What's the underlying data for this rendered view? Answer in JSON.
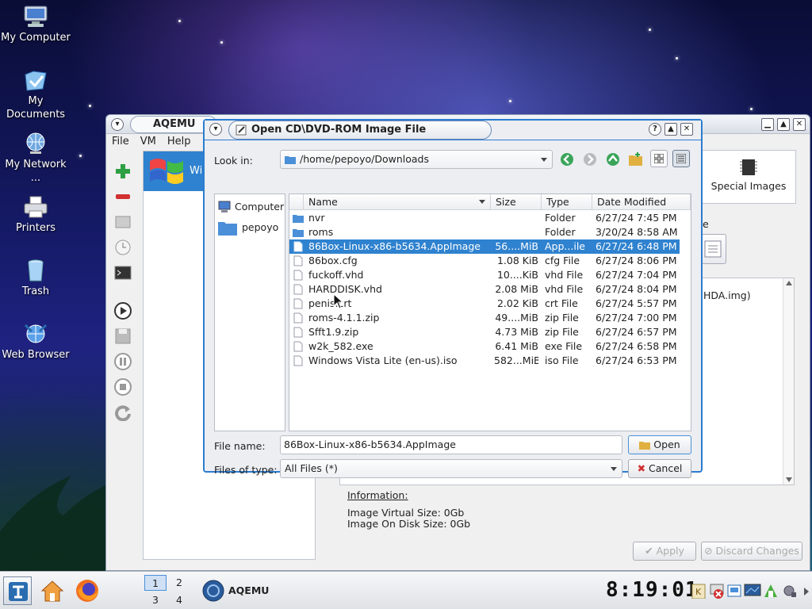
{
  "desktop": {
    "icons": [
      {
        "label": "My Computer",
        "icon": "computer-icon"
      },
      {
        "label": "My Documents",
        "icon": "documents-icon"
      },
      {
        "label": "My Network ...",
        "icon": "network-icon"
      },
      {
        "label": "Printers",
        "icon": "printer-icon"
      },
      {
        "label": "Trash",
        "icon": "trash-icon"
      },
      {
        "label": "Web Browser",
        "icon": "web-browser-icon"
      }
    ]
  },
  "aqemu": {
    "title": "AQEMU",
    "menu": [
      "File",
      "VM",
      "Help"
    ],
    "vm_item": "Wi",
    "special_images": "Special Images",
    "partial_label": "e",
    "hda_text": "HDA.img)",
    "information_label": "Information:",
    "virtual_size": "Image Virtual Size: 0Gb",
    "disk_size": "Image On Disk Size: 0Gb",
    "apply_button": "Apply",
    "discard_button": "Discard Changes"
  },
  "dialog": {
    "title": "Open CD\\DVD-ROM Image File",
    "look_in_label": "Look in:",
    "look_in_value": "/home/pepoyo/Downloads",
    "sidebar": [
      "Computer",
      "pepoyo"
    ],
    "columns": [
      "Name",
      "Size",
      "Type",
      "Date Modified"
    ],
    "files": [
      {
        "name": "nvr",
        "size": "",
        "type": "Folder",
        "date": "6/27/24 7:45 PM",
        "kind": "folder"
      },
      {
        "name": "roms",
        "size": "",
        "type": "Folder",
        "date": "3/20/24 8:58 AM",
        "kind": "folder"
      },
      {
        "name": "86Box-Linux-x86-b5634.AppImage",
        "size": "56....MiB",
        "type": "App...ile",
        "date": "6/27/24 6:48 PM",
        "kind": "file",
        "selected": true
      },
      {
        "name": "86box.cfg",
        "size": "1.08 KiB",
        "type": "cfg File",
        "date": "6/27/24 8:06 PM",
        "kind": "file"
      },
      {
        "name": "fuckoff.vhd",
        "size": "10....KiB",
        "type": "vhd File",
        "date": "6/27/24 7:04 PM",
        "kind": "file"
      },
      {
        "name": "HARDDISK.vhd",
        "size": "2.08 MiB",
        "type": "vhd File",
        "date": "6/27/24 8:04 PM",
        "kind": "file"
      },
      {
        "name": "penis.crt",
        "size": "2.02 KiB",
        "type": "crt File",
        "date": "6/27/24 5:57 PM",
        "kind": "file"
      },
      {
        "name": "roms-4.1.1.zip",
        "size": "49....MiB",
        "type": "zip File",
        "date": "6/27/24 7:00 PM",
        "kind": "file"
      },
      {
        "name": "Sfft1.9.zip",
        "size": "4.73 MiB",
        "type": "zip File",
        "date": "6/27/24 6:57 PM",
        "kind": "file"
      },
      {
        "name": "w2k_582.exe",
        "size": "6.41 MiB",
        "type": "exe File",
        "date": "6/27/24 6:58 PM",
        "kind": "file"
      },
      {
        "name": "Windows Vista Lite (en-us).iso",
        "size": "582...MiB",
        "type": "iso File",
        "date": "6/27/24 6:53 PM",
        "kind": "file"
      }
    ],
    "filename_label": "File name:",
    "filename_value": "86Box-Linux-x86-b5634.AppImage",
    "filetype_label": "Files of type:",
    "filetype_value": "All Files (*)",
    "open_button": "Open",
    "cancel_button": "Cancel"
  },
  "taskbar": {
    "workspaces": [
      "1",
      "2",
      "3",
      "4"
    ],
    "task_label": "AQEMU",
    "clock": "8:19:01"
  },
  "colors": {
    "selection": "#2f82cf",
    "dialog_border": "#2c7cd0",
    "add_green": "#2ea043",
    "remove_red": "#d03030"
  }
}
